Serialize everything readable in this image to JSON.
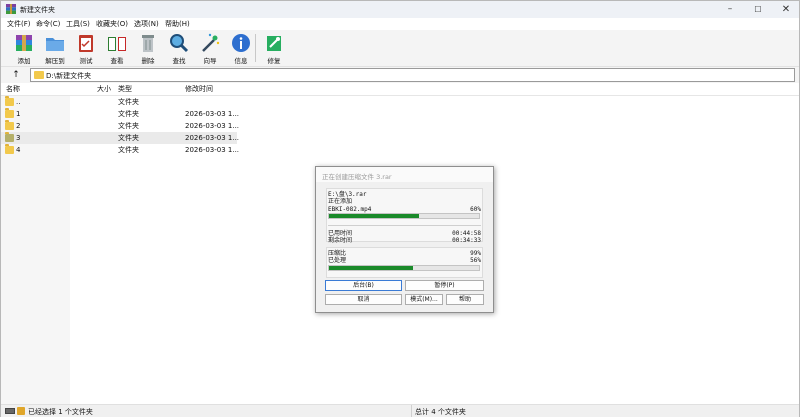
{
  "window": {
    "title": "新建文件夹"
  },
  "menu": [
    "文件(F)",
    "命令(C)",
    "工具(S)",
    "收藏夹(O)",
    "选项(N)",
    "帮助(H)"
  ],
  "toolbar": {
    "add": "添加",
    "extract": "解压到",
    "test": "测试",
    "view": "查看",
    "delete": "删除",
    "find": "查找",
    "wizard": "向导",
    "info": "信息",
    "repair": "修复"
  },
  "address": {
    "path": "D:\\新建文件夹"
  },
  "columns": {
    "name": "名称",
    "size": "大小",
    "type": "类型",
    "modified": "修改时间"
  },
  "rows": [
    {
      "name": "..",
      "size": "",
      "type": "文件夹",
      "modified": "",
      "selected": false
    },
    {
      "name": "1",
      "size": "",
      "type": "文件夹",
      "modified": "2026-03-03 1...",
      "selected": false
    },
    {
      "name": "2",
      "size": "",
      "type": "文件夹",
      "modified": "2026-03-03 1...",
      "selected": false
    },
    {
      "name": "3",
      "size": "",
      "type": "文件夹",
      "modified": "2026-03-03 1...",
      "selected": true
    },
    {
      "name": "4",
      "size": "",
      "type": "文件夹",
      "modified": "2026-03-03 1...",
      "selected": false
    }
  ],
  "status": {
    "left": "已经选择 1 个文件夹",
    "right": "总计 4 个文件夹"
  },
  "dialog": {
    "title": "正在创建压缩文件 3.rar",
    "archive_path": "E:\\盘\\3.rar",
    "action": "正在添加",
    "current_file": "EBKI-082.mp4",
    "file_percent": "60%",
    "file_progress": 0.6,
    "elapsed_label": "已用时间",
    "elapsed_value": "00:44:58",
    "remaining_label": "剩余时间",
    "remaining_value": "00:34:33",
    "ratio_label": "压缩比",
    "ratio_value": "99%",
    "processed_label": "已处理",
    "processed_value": "56%",
    "processed_progress": 0.56,
    "buttons": {
      "background": "后台(B)",
      "pause": "暂停(P)",
      "cancel": "取消",
      "mode": "模式(M)...",
      "help": "帮助"
    }
  }
}
